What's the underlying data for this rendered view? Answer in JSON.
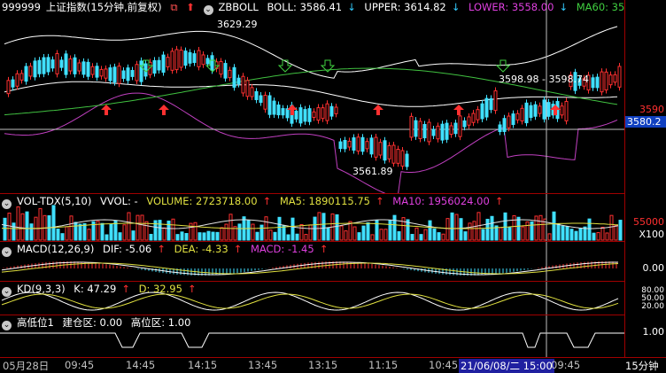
{
  "main": {
    "code": "999999",
    "name": "上证指数(15分钟,前复权)",
    "indicator": "ZBBOLL",
    "boll_label": "BOLL: 3586.41",
    "upper_label": "UPPER: 3614.82",
    "lower_label": "LOWER: 3558.00",
    "ma60_label": "MA60: 35",
    "ann_high": "3629.29",
    "ann_low": "3561.89",
    "ann_mid": "3598.98 - 3598.74",
    "price_tick": "3590",
    "current_price": "3580.2"
  },
  "volume": {
    "name": "VOL-TDX(5,10)",
    "vvol": "VVOL: -",
    "volume_label": "VOLUME: 2723718.00",
    "ma5_label": "MA5: 1890115.75",
    "ma10_label": "MA10: 1956024.00",
    "tick": "55000",
    "unit": "X100"
  },
  "macd": {
    "name": "MACD(12,26,9)",
    "dif_label": "DIF: -5.06",
    "dea_label": "DEA: -4.33",
    "macd_label": "MACD: -1.45",
    "tick": "0.00"
  },
  "kd": {
    "name": "KD(9,3,3)",
    "k_label": "K: 47.29",
    "d_label": "D: 32.95",
    "tick_top": "80.00",
    "tick_mid": "50.00",
    "tick_bot": "20.00"
  },
  "hl": {
    "name": "高低位1",
    "jc_label": "建仓区: 0.00",
    "gw_label": "高位区: 1.00",
    "tick": "1.00"
  },
  "timeaxis": {
    "labels": [
      "05月28日",
      "09:45",
      "14:45",
      "14:15",
      "13:45",
      "13:15",
      "11:15",
      "10:45",
      "21/06/08/二 15:00",
      "09:45"
    ],
    "period": "15分钟"
  },
  "colors": {
    "frame": "#a00000",
    "up": "#ff3030",
    "down": "#40e0ff",
    "boll_mid": "#ffffff",
    "upper": "#ffffff",
    "lower": "#c040c0",
    "ma60": "#40c040",
    "yellow": "#e0e040"
  }
}
